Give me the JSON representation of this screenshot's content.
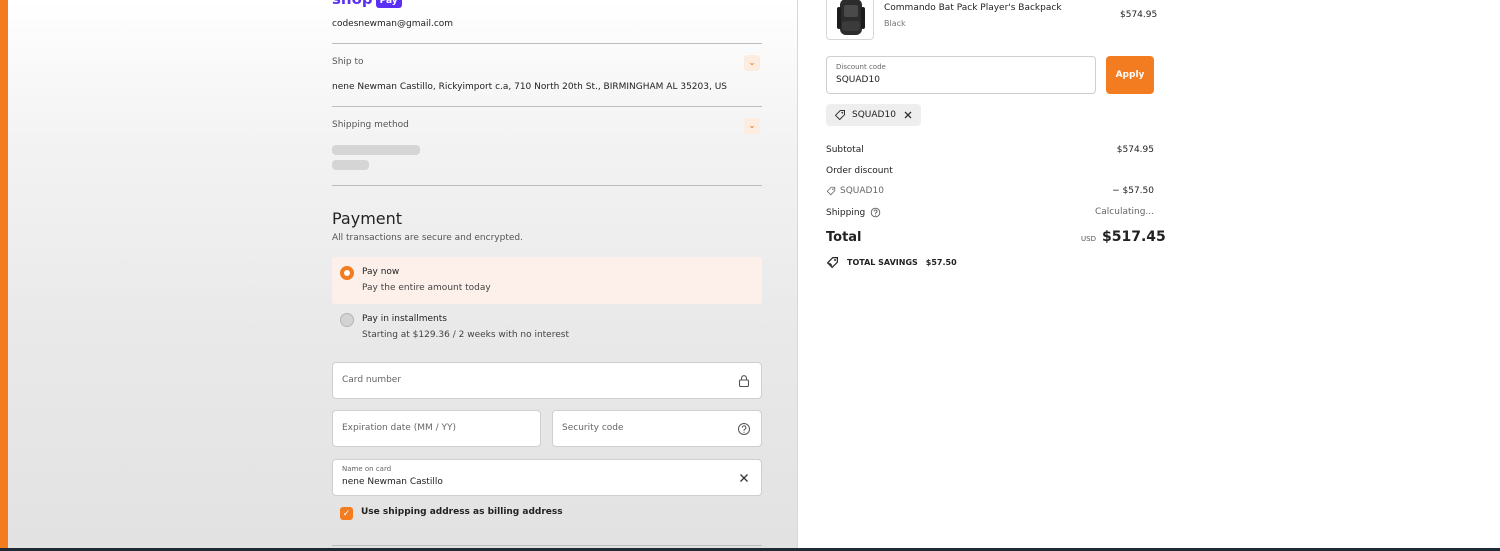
{
  "brand": {
    "logo_text": "shop",
    "logo_badge": "Pay",
    "accent_color": "#f47c20",
    "shop_pay_color": "#5a31f4"
  },
  "contact": {
    "email": "codesnewman@gmail.com"
  },
  "ship_to": {
    "label": "Ship to",
    "address": "nene Newman Castillo, Rickyimport c.a, 710 North 20th St., BIRMINGHAM AL 35203, US"
  },
  "shipping_method": {
    "label": "Shipping method"
  },
  "payment": {
    "title": "Payment",
    "subtitle": "All transactions are secure and encrypted.",
    "options": [
      {
        "title": "Pay now",
        "description": "Pay the entire amount today",
        "selected": true
      },
      {
        "title": "Pay in installments",
        "description": "Starting at $129.36 / 2 weeks with no interest",
        "selected": false
      }
    ],
    "card_number_placeholder": "Card number",
    "expiration_placeholder": "Expiration date (MM / YY)",
    "security_placeholder": "Security code",
    "name_label": "Name on card",
    "name_value": "nene Newman Castillo",
    "billing_checkbox_label": "Use shipping address as billing address",
    "billing_checked": true
  },
  "order": {
    "product": {
      "name": "Commando Bat Pack Player's Backpack",
      "variant": "Black",
      "price": "$574.95"
    },
    "discount": {
      "label": "Discount code",
      "value": "SQUAD10",
      "apply_label": "Apply",
      "applied_code": "SQUAD10"
    },
    "summary": {
      "subtotal_label": "Subtotal",
      "subtotal_value": "$574.95",
      "order_discount_label": "Order discount",
      "discount_code": "SQUAD10",
      "discount_value": "− $57.50",
      "shipping_label": "Shipping",
      "shipping_value": "Calculating...",
      "total_label": "Total",
      "total_currency": "USD",
      "total_value": "$517.45",
      "savings_label": "TOTAL SAVINGS",
      "savings_value": "$57.50"
    }
  }
}
